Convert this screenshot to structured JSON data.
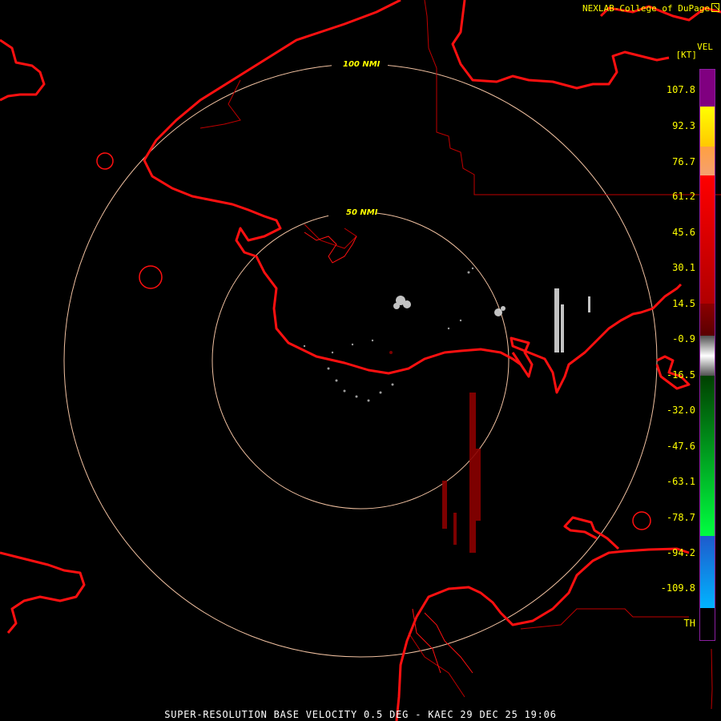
{
  "credit": "NEXLAB-College of DuPage",
  "legend": {
    "title": "VEL",
    "unit": "[KT]",
    "ticks": [
      "107.8",
      "92.3",
      "76.7",
      "61.2",
      "45.6",
      "30.1",
      "14.5",
      "-0.9",
      "-16.5",
      "-32.0",
      "-47.6",
      "-63.1",
      "-78.7",
      "-94.2",
      "-109.8",
      "TH"
    ],
    "colors": {
      "purple": "#800080",
      "yellow": "#ffff00",
      "peach": "#f5a070",
      "red": "#ff0000",
      "darkred": "#8b0000",
      "gray": "#a0a0a0",
      "green": "#00cc00",
      "blue": "#1e5acc",
      "cyan": "#00b4ff"
    }
  },
  "rings": [
    {
      "label": "50 NMI"
    },
    {
      "label": "100 NMI"
    }
  ],
  "caption": "SUPER-RESOLUTION BASE VELOCITY 0.5 DEG - KAEC 29 DEC 25 19:06"
}
